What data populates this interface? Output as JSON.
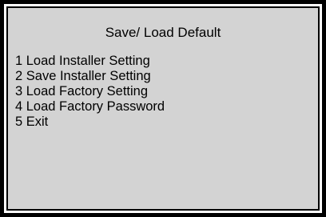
{
  "screen": {
    "title": "Save/ Load Default",
    "menu_items": [
      "1 Load Installer Setting",
      "2 Save Installer Setting",
      "3 Load Factory Setting",
      "4 Load Factory Password",
      "5 Exit"
    ]
  },
  "colors": {
    "frame": "#000000",
    "background": "#d3d3d3",
    "text": "#000000"
  }
}
